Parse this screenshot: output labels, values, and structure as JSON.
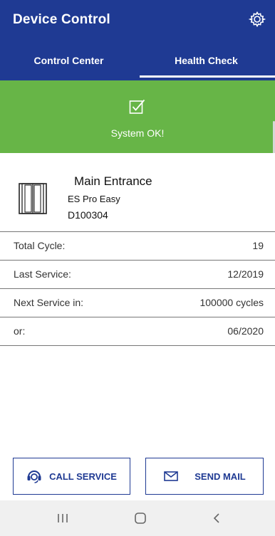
{
  "app": {
    "title": "Device Control"
  },
  "tabs": [
    {
      "label": "Control Center",
      "active": false
    },
    {
      "label": "Health Check",
      "active": true
    }
  ],
  "status": {
    "text": "System OK!",
    "color": "#67b547",
    "icon": "checkbox-checked-icon"
  },
  "device": {
    "name": "Main Entrance",
    "model": "ES Pro Easy",
    "serial": "D100304",
    "icon": "door-icon"
  },
  "details": [
    {
      "label": "Total Cycle:",
      "value": "19"
    },
    {
      "label": "Last Service:",
      "value": "12/2019"
    },
    {
      "label": "Next Service in:",
      "value": "100000 cycles"
    },
    {
      "label": "or:",
      "value": "06/2020"
    }
  ],
  "actions": {
    "call_label": "CALL SERVICE",
    "mail_label": "SEND MAIL"
  },
  "colors": {
    "primary": "#1f3a93",
    "success": "#67b547",
    "navbar": "#f0f0f0"
  },
  "navigation": {
    "icons": [
      "recents-icon",
      "home-icon",
      "back-icon"
    ]
  }
}
